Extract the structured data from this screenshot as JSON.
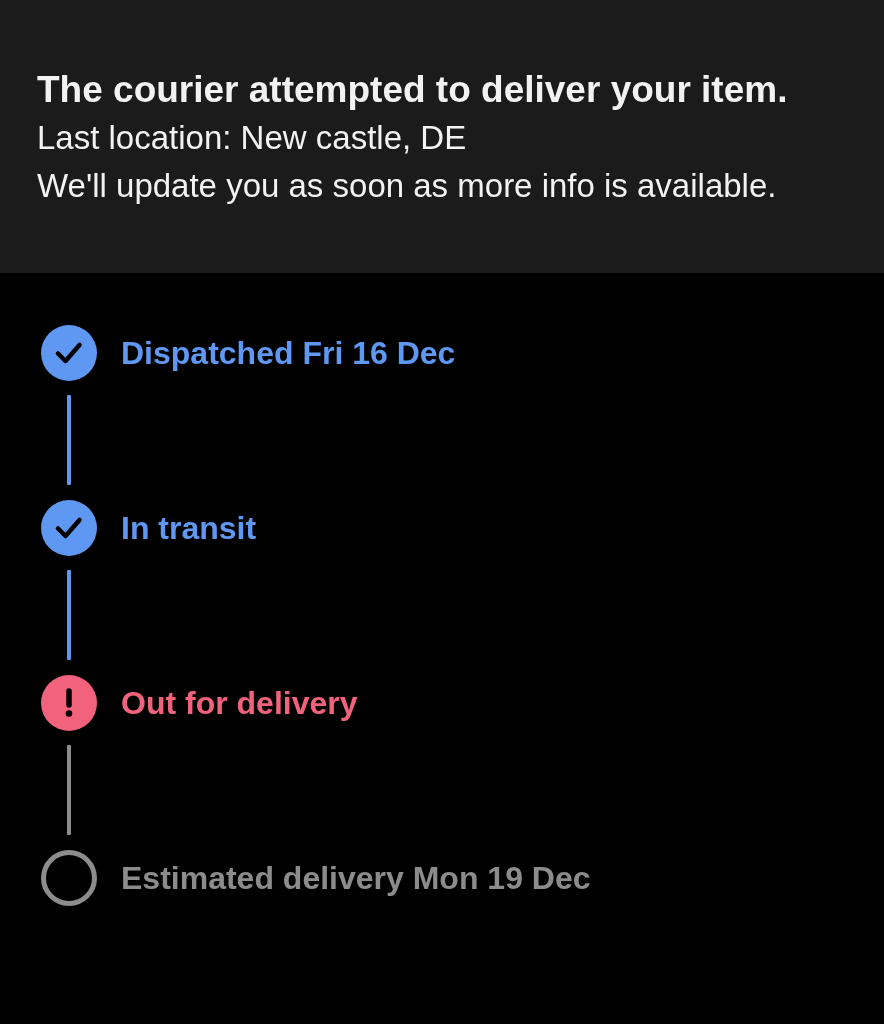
{
  "notice": {
    "title": "The courier attempted to deliver your item.",
    "lines": [
      "Last location: New castle, DE",
      "We'll update you as soon as more info is available."
    ]
  },
  "steps": [
    {
      "label": "Dispatched Fri 16 Dec",
      "kind": "done"
    },
    {
      "label": "In transit",
      "kind": "done"
    },
    {
      "label": "Out for delivery",
      "kind": "alert"
    },
    {
      "label": "Estimated delivery Mon 19 Dec",
      "kind": "pending"
    }
  ]
}
